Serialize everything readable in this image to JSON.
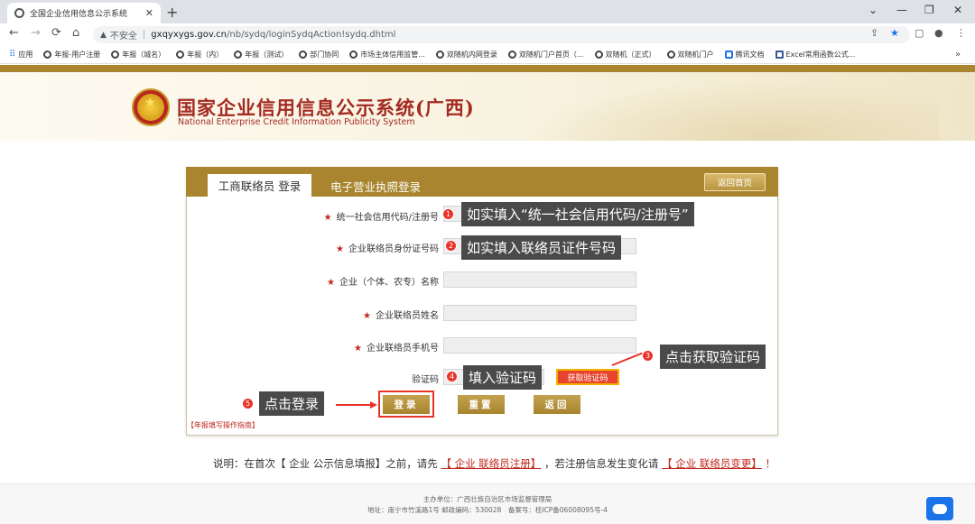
{
  "browser": {
    "tab_title": "全国企业信用信息公示系统",
    "tab_close": "✕",
    "new_tab": "+",
    "window_controls": [
      "⌄",
      "—",
      "❐",
      "✕"
    ],
    "nav": [
      "←",
      "→",
      "⟳",
      "⌂"
    ],
    "security_warning": "▲",
    "security_label": "不安全",
    "url_host": "gxqyxygs.gov.cn",
    "url_path": "/nb/sydq/loginSydqAction!sydq.dhtml",
    "omni_icons": [
      "⇪",
      "★",
      "▢",
      "●",
      "⋮"
    ],
    "bookmarks": [
      {
        "label": "应用",
        "icon": "apps-icon"
      },
      {
        "label": "年报-用户注册",
        "icon": "globe-icon"
      },
      {
        "label": "年报（城名）",
        "icon": "globe-icon"
      },
      {
        "label": "年报（内）",
        "icon": "globe-icon"
      },
      {
        "label": "年报（测试）",
        "icon": "globe-icon"
      },
      {
        "label": "部门协同",
        "icon": "globe-icon"
      },
      {
        "label": "市场主体信用监管...",
        "icon": "globe-icon"
      },
      {
        "label": "双随机内网登录",
        "icon": "globe-icon"
      },
      {
        "label": "双随机门户首页（...",
        "icon": "globe-icon"
      },
      {
        "label": "双随机（正式）",
        "icon": "globe-icon"
      },
      {
        "label": "双随机门户",
        "icon": "globe-icon"
      },
      {
        "label": "腾讯文档",
        "icon": "doc-icon"
      },
      {
        "label": "Excel常用函数公式...",
        "icon": "image-icon"
      }
    ],
    "bookmarks_more": "»"
  },
  "header": {
    "title": "国家企业信用信息公示系统(广西)",
    "subtitle": "National Enterprise Credit Information Publicity System"
  },
  "login": {
    "tab_active": "工商联络员 登录",
    "tab_inactive": "电子营业执照登录",
    "home_button": "返回首页",
    "required_mark": "★",
    "fields": {
      "credit_code": "统一社会信用代码/注册号",
      "id_number": "企业联络员身份证号码",
      "company_name": "企业（个体、农专）名称",
      "contact_name": "企业联络员姓名",
      "contact_phone": "企业联络员手机号",
      "captcha": "验证码"
    },
    "get_captcha_button": "获取验证码",
    "login_button": "登录",
    "reset_button": "重置",
    "back_button": "返回",
    "guide_link": "【年报填写操作指南】"
  },
  "annotations": {
    "n1": "1",
    "t1": "如实填入“统一社会信用代码/注册号”",
    "n2": "2",
    "t2": "如实填入联络员证件号码",
    "n3": "3",
    "t3": "点击获取验证码",
    "n4": "4",
    "t4": "填入验证码",
    "n5": "5",
    "t5": "点击登录"
  },
  "description": {
    "prefix": "说明：在首次【 企业 公示信息填报】之前，请先",
    "link1": "【 企业 联络员注册】",
    "middle": "，若注册信息发生变化请",
    "link2": "【 企业 联络员变更】",
    "suffix": "！"
  },
  "footer": {
    "line1": "主办单位：广西壮族自治区市场监督管理局",
    "line2": "地址：南宁市竹溪路1号 邮政编码：530028　备案号：桂ICP备06008095号-4"
  },
  "colors": {
    "gold": "#a8852e",
    "red": "#c0281d",
    "annotation_bg": "#4a4a4a",
    "badge_red": "#e8332a"
  }
}
